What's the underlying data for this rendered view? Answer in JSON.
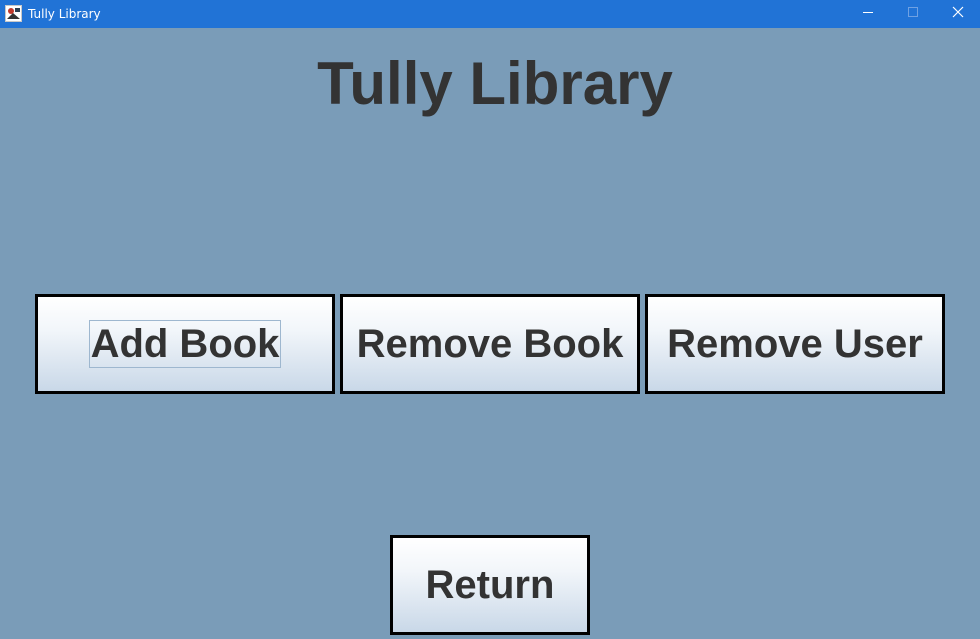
{
  "window": {
    "title": "Tully Library",
    "controls": [
      "minimize-icon",
      "maximize-icon",
      "close-icon"
    ]
  },
  "main": {
    "heading": "Tully Library",
    "buttons": {
      "add_book": "Add Book",
      "remove_book": "Remove Book",
      "remove_user": "Remove User",
      "return": "Return"
    },
    "focused_button": "Add Book"
  },
  "colors": {
    "titlebar": "#2173d6",
    "background": "#7a9cb8",
    "text": "#333333",
    "button_border": "#000000"
  }
}
